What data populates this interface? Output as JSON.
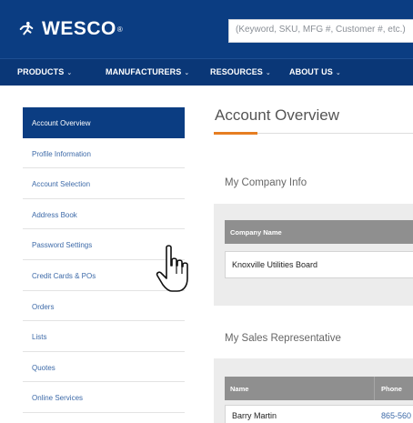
{
  "header": {
    "brand": "WESCO",
    "brand_reg": "®",
    "search_placeholder": "(Keyword, SKU, MFG #, Customer #, etc.)"
  },
  "nav": {
    "items": [
      {
        "label": "PRODUCTS"
      },
      {
        "label": "MANUFACTURERS"
      },
      {
        "label": "RESOURCES"
      },
      {
        "label": "ABOUT US"
      }
    ],
    "chevron": "⌄"
  },
  "sidebar": {
    "items": [
      {
        "label": "Account Overview",
        "active": true
      },
      {
        "label": "Profile Information"
      },
      {
        "label": "Account Selection"
      },
      {
        "label": "Address Book"
      },
      {
        "label": "Password Settings"
      },
      {
        "label": "Credit Cards & POs"
      },
      {
        "label": "Orders"
      },
      {
        "label": "Lists"
      },
      {
        "label": "Quotes"
      },
      {
        "label": "Online Services"
      }
    ]
  },
  "main": {
    "title": "Account Overview",
    "accent_color": "#e67e22",
    "company": {
      "section_title": "My Company Info",
      "header_company_name": "Company Name",
      "company_name": "Knoxville Utilities Board"
    },
    "sales_rep": {
      "section_title": "My Sales Representative",
      "header_name": "Name",
      "header_phone": "Phone",
      "name": "Barry Martin",
      "phone": "865-560"
    }
  },
  "colors": {
    "header_bg": "#0b3d82",
    "nav_bg": "#0a3777",
    "sidebar_active_bg": "#0b3d82",
    "link": "#3d6aa8",
    "table_header_bg": "#8f8f8f"
  },
  "icons": {
    "logo": "wesco-runner-logo",
    "cursor": "hand-pointer-cursor"
  }
}
